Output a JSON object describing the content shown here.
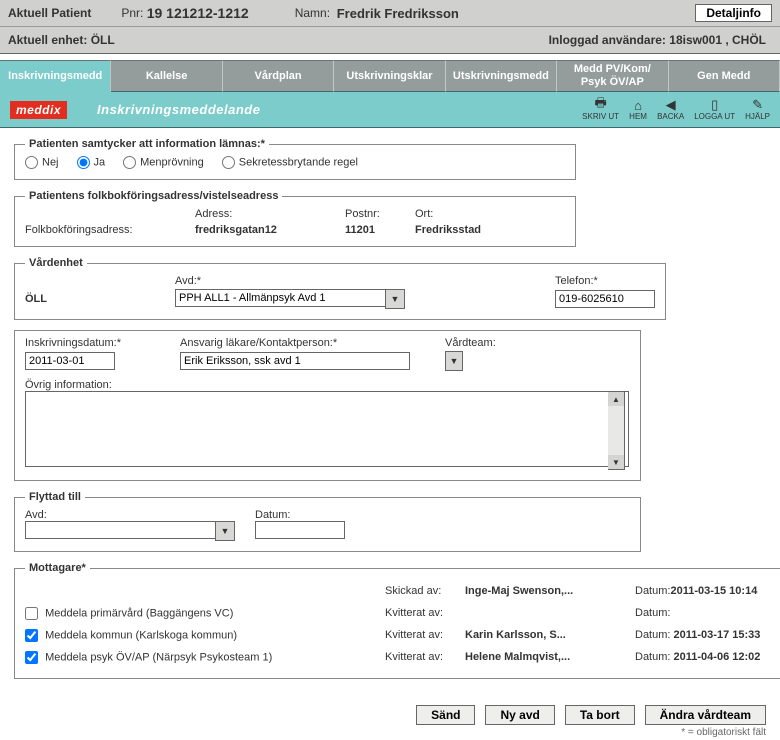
{
  "header": {
    "aktuell_patient": "Aktuell Patient",
    "pnr_label": "Pnr:",
    "pnr": "19 121212-1212",
    "namn_label": "Namn:",
    "namn": "Fredrik Fredriksson",
    "detaljinfo": "Detaljinfo",
    "aktuell_enhet_label": "Aktuell enhet:",
    "aktuell_enhet": "ÖLL",
    "inloggad_label": "Inloggad användare:",
    "inloggad": "18isw001 , CHÖL"
  },
  "tabs": [
    "Inskrivningsmedd",
    "Kallelse",
    "Vårdplan",
    "Utskrivningsklar",
    "Utskrivningsmedd",
    "Medd PV/Kom/\nPsyk ÖV/AP",
    "Gen Medd"
  ],
  "brand": "meddix",
  "strip_title": "Inskrivningsmeddelande",
  "toolbar": {
    "skriv_ut": "SKRIV UT",
    "hem": "HEM",
    "backa": "BACKA",
    "logga_ut": "LOGGA UT",
    "hjalp": "HJÄLP"
  },
  "consent": {
    "legend": "Patienten samtycker att information lämnas:*",
    "nej": "Nej",
    "ja": "Ja",
    "men": "Menprövning",
    "sek": "Sekretessbrytande regel"
  },
  "addr": {
    "legend": "Patientens folkbokföringsadress/vistelseadress",
    "adress_h": "Adress:",
    "postnr_h": "Postnr:",
    "ort_h": "Ort:",
    "folk": "Folkbokföringsadress:",
    "adress": "fredriksgatan12",
    "postnr": "11201",
    "ort": "Fredriksstad"
  },
  "vard": {
    "legend": "Vårdenhet",
    "avd_h": "Avd:*",
    "tel_h": "Telefon:*",
    "enhet": "ÖLL",
    "avd": "PPH ALL1 - Allmänpsyk Avd 1",
    "tel": "019-6025610"
  },
  "ins": {
    "datum_h": "Inskrivningsdatum:*",
    "ansv_h": "Ansvarig läkare/Kontaktperson:*",
    "vteam_h": "Vårdteam:",
    "datum": "2011-03-01",
    "ansv": "Erik Eriksson, ssk avd 1",
    "ovrig_h": "Övrig information:"
  },
  "fly": {
    "legend": "Flyttad till",
    "avd_h": "Avd:",
    "datum_h": "Datum:"
  },
  "mott": {
    "legend": "Mottagare*",
    "skickad_h": "Skickad av:",
    "skickad": "Inge-Maj Swenson,...",
    "skickad_d_h": "Datum:",
    "skickad_d": "2011-03-15 10:14",
    "r1": {
      "cb": "Meddela primärvård  (Baggängens VC)",
      "kv": ""
    },
    "r2": {
      "cb": "Meddela kommun  (Karlskoga kommun)",
      "kv": "Karin Karlsson, S...",
      "d": "2011-03-17 15:33"
    },
    "r3": {
      "cb": "Meddela psyk ÖV/AP  (Närpsyk Psykosteam 1)",
      "kv": "Helene Malmqvist,...",
      "d": "2011-04-06 12:02"
    },
    "kvit_h": "Kvitterat av:",
    "d_h": "Datum:"
  },
  "buttons": {
    "sand": "Sänd",
    "ny_avd": "Ny avd",
    "ta_bort": "Ta bort",
    "andra": "Ändra vårdteam"
  },
  "foot": "*  =  obligatoriskt fält"
}
